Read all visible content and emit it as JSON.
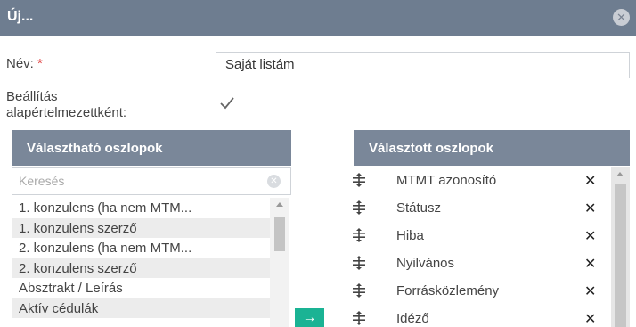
{
  "dialog": {
    "title": "Új..."
  },
  "form": {
    "name_label": "Név:",
    "required_mark": "*",
    "name_value": "Saját listám",
    "default_label_line1": "Beállítás",
    "default_label_line2": "alapértelmezettként:",
    "default_checked": true
  },
  "available": {
    "header": "Választható oszlopok",
    "search_placeholder": "Keresés",
    "items": [
      "1. konzulens (ha nem MTM...",
      "1. konzulens szerző",
      "2. konzulens (ha nem MTM...",
      "2. konzulens szerző",
      "Absztrakt / Leírás",
      "Aktív cédulák"
    ]
  },
  "move_button": {
    "label": "→"
  },
  "selected": {
    "header": "Választott oszlopok",
    "items": [
      "MTMT azonosító",
      "Státusz",
      "Hiba",
      "Nyilvános",
      "Forrásközlemény",
      "Idéző"
    ]
  },
  "colors": {
    "titlebar": "#6e7d90",
    "panel_header": "#7a8799",
    "accent": "#1ab394"
  }
}
